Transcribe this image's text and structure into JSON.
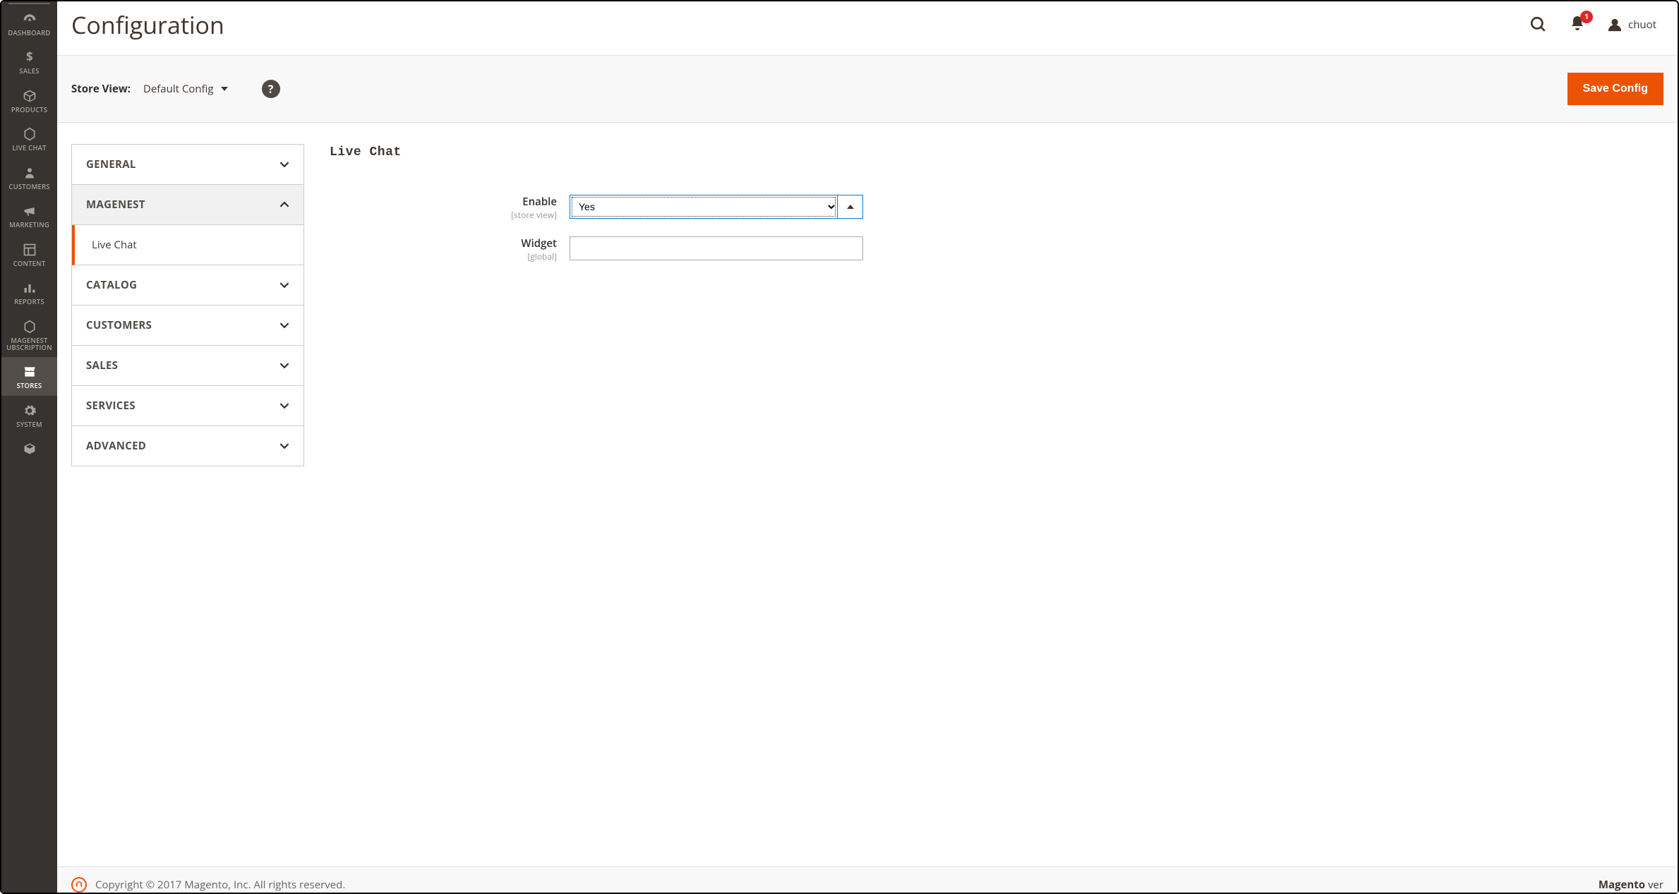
{
  "sidebar": {
    "items": [
      {
        "label": "DASHBOARD"
      },
      {
        "label": "SALES"
      },
      {
        "label": "PRODUCTS"
      },
      {
        "label": "LIVE CHAT"
      },
      {
        "label": "CUSTOMERS"
      },
      {
        "label": "MARKETING"
      },
      {
        "label": "CONTENT"
      },
      {
        "label": "REPORTS"
      },
      {
        "label": "MAGENEST UBSCRIPTION"
      },
      {
        "label": "STORES"
      },
      {
        "label": "SYSTEM"
      }
    ]
  },
  "header": {
    "title": "Configuration",
    "notification_count": "1",
    "username": "chuot"
  },
  "scope": {
    "label": "Store View:",
    "value": "Default Config",
    "save_button": "Save Config"
  },
  "tabs": {
    "general": "GENERAL",
    "magenest": "MAGENEST",
    "magenest_sub": "Live Chat",
    "catalog": "CATALOG",
    "customers": "CUSTOMERS",
    "sales": "SALES",
    "services": "SERVICES",
    "advanced": "ADVANCED"
  },
  "form": {
    "section_title": "Live Chat",
    "enable": {
      "label": "Enable",
      "scope": "[store view]",
      "value": "Yes"
    },
    "widget": {
      "label": "Widget",
      "scope": "[global]",
      "value": ""
    }
  },
  "footer": {
    "copyright": "Copyright © 2017 Magento, Inc. All rights reserved.",
    "brand_bold": "Magento",
    "brand_rest": " ver"
  }
}
